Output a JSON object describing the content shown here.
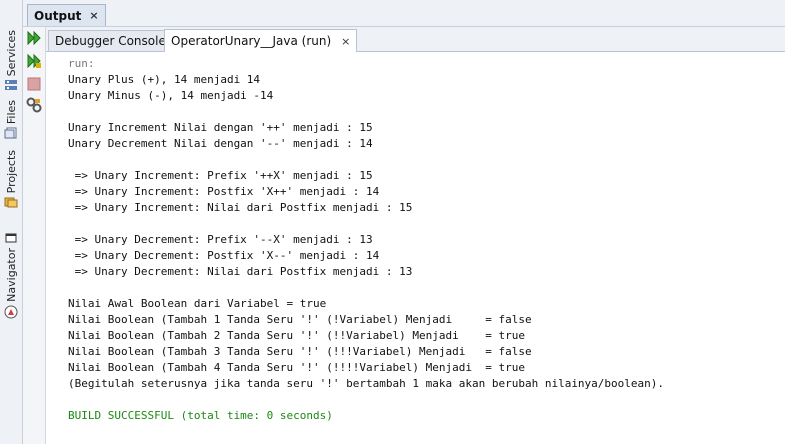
{
  "side_tabs": [
    {
      "label": "Services",
      "icon": "services-icon"
    },
    {
      "label": "Files",
      "icon": "files-icon"
    },
    {
      "label": "Projects",
      "icon": "projects-icon"
    },
    {
      "label": "Navigator",
      "icon": "navigator-icon"
    }
  ],
  "output_tab": {
    "label": "Output",
    "close": "×"
  },
  "inner_tabs": [
    {
      "label": "Debugger Console",
      "close": "×",
      "active": false
    },
    {
      "label": "OperatorUnary__Java (run)",
      "close": "×",
      "active": true
    }
  ],
  "console": {
    "lines": [
      {
        "text": "run:",
        "style": "gray"
      },
      {
        "text": "Unary Plus (+), 14 menjadi 14",
        "style": "normal"
      },
      {
        "text": "Unary Minus (-), 14 menjadi -14",
        "style": "normal"
      },
      {
        "text": "",
        "style": "normal"
      },
      {
        "text": "Unary Increment Nilai dengan '++' menjadi : 15",
        "style": "normal"
      },
      {
        "text": "Unary Decrement Nilai dengan '--' menjadi : 14",
        "style": "normal"
      },
      {
        "text": "",
        "style": "normal"
      },
      {
        "text": " => Unary Increment: Prefix '++X' menjadi : 15",
        "style": "normal"
      },
      {
        "text": " => Unary Increment: Postfix 'X++' menjadi : 14",
        "style": "normal"
      },
      {
        "text": " => Unary Increment: Nilai dari Postfix menjadi : 15",
        "style": "normal"
      },
      {
        "text": "",
        "style": "normal"
      },
      {
        "text": " => Unary Decrement: Prefix '--X' menjadi : 13",
        "style": "normal"
      },
      {
        "text": " => Unary Decrement: Postfix 'X--' menjadi : 14",
        "style": "normal"
      },
      {
        "text": " => Unary Decrement: Nilai dari Postfix menjadi : 13",
        "style": "normal"
      },
      {
        "text": "",
        "style": "normal"
      },
      {
        "text": "Nilai Awal Boolean dari Variabel = true",
        "style": "normal"
      },
      {
        "text": "Nilai Boolean (Tambah 1 Tanda Seru '!' (!Variabel) Menjadi     = false",
        "style": "normal"
      },
      {
        "text": "Nilai Boolean (Tambah 2 Tanda Seru '!' (!!Variabel) Menjadi    = true",
        "style": "normal"
      },
      {
        "text": "Nilai Boolean (Tambah 3 Tanda Seru '!' (!!!Variabel) Menjadi   = false",
        "style": "normal"
      },
      {
        "text": "Nilai Boolean (Tambah 4 Tanda Seru '!' (!!!!Variabel) Menjadi  = true",
        "style": "normal"
      },
      {
        "text": "(Begitulah seterusnya jika tanda seru '!' bertambah 1 maka akan berubah nilainya/boolean).",
        "style": "normal"
      },
      {
        "text": "",
        "style": "normal"
      },
      {
        "text": "BUILD SUCCESSFUL (total time: 0 seconds)",
        "style": "green"
      }
    ]
  },
  "colors": {
    "build_success": "#1a8a12",
    "run_label": "#7a7a7a",
    "toolbar_green": "#3ea832"
  }
}
